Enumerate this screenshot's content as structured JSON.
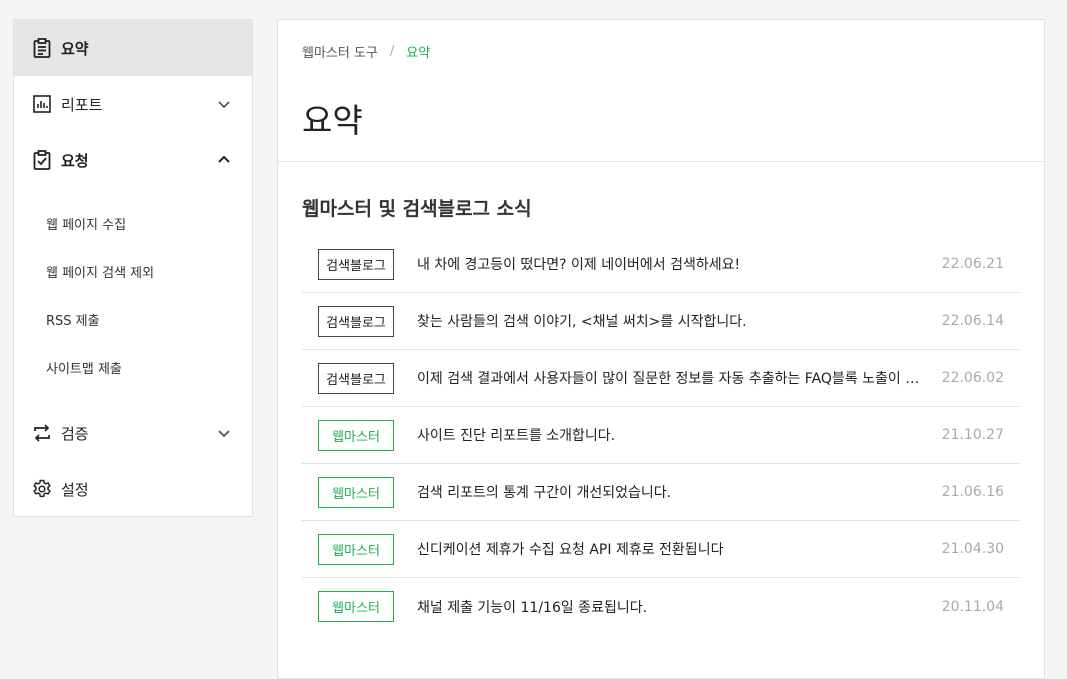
{
  "sidebar": {
    "items": [
      {
        "label": "요약",
        "icon": "clipboard-icon"
      },
      {
        "label": "리포트",
        "icon": "bar-chart-icon"
      },
      {
        "label": "요청",
        "icon": "clipboard-check-icon"
      },
      {
        "label": "검증",
        "icon": "repeat-icon"
      },
      {
        "label": "설정",
        "icon": "gear-icon"
      }
    ],
    "sub_items": [
      {
        "label": "웹 페이지 수집"
      },
      {
        "label": "웹 페이지 검색 제외"
      },
      {
        "label": "RSS 제출"
      },
      {
        "label": "사이트맵 제출"
      }
    ]
  },
  "main": {
    "breadcrumb": {
      "root": "웹마스터 도구",
      "separator": "/",
      "current": "요약"
    },
    "title": "요약",
    "section_title": "웹마스터 및 검색블로그 소식",
    "news": [
      {
        "tag": "검색블로그",
        "title": "내 차에 경고등이 떴다면? 이제 네이버에서 검색하세요!",
        "date": "22.06.21"
      },
      {
        "tag": "검색블로그",
        "title": "찾는 사람들의 검색 이야기, <채널 써치>를 시작합니다.",
        "date": "22.06.14"
      },
      {
        "tag": "검색블로그",
        "title": "이제 검색 결과에서 사용자들이 많이 질문한 정보를 자동 추출하는 FAQ블록 노출이 가능합니다",
        "date": "22.06.02"
      },
      {
        "tag": "웹마스터",
        "title": "사이트 진단 리포트를 소개합니다.",
        "date": "21.10.27"
      },
      {
        "tag": "웹마스터",
        "title": "검색 리포트의 통계 구간이 개선되었습니다.",
        "date": "21.06.16"
      },
      {
        "tag": "웹마스터",
        "title": "신디케이션 제휴가 수집 요청 API 제휴로 전환됩니다",
        "date": "21.04.30"
      },
      {
        "tag": "웹마스터",
        "title": "채널 제출 기능이 11/16일 종료됩니다.",
        "date": "20.11.04"
      }
    ]
  },
  "colors": {
    "accent": "#1fae4b",
    "active_bg": "#e6e6e6",
    "date": "#aaaaaa"
  }
}
